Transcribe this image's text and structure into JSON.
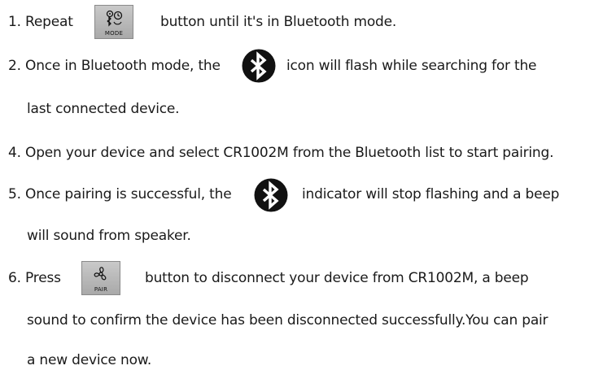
{
  "steps": [
    {
      "id": "1",
      "before": "1. Repeat",
      "after": "button until it's in Bluetooth mode.",
      "button_caption": "MODE"
    },
    {
      "id": "2",
      "before": "2. Once in Bluetooth mode, the",
      "after": "icon will flash while searching for the",
      "continuation": "last connected device."
    },
    {
      "id": "4",
      "text": "4. Open your device and select CR1002M from the Bluetooth list to start pairing."
    },
    {
      "id": "5",
      "before": "5. Once pairing is successful, the",
      "after": "indicator will stop flashing and a beep",
      "continuation": "will sound from speaker."
    },
    {
      "id": "6",
      "before": "6. Press",
      "after": "button to disconnect your device from CR1002M, a beep",
      "button_caption": "PAIR",
      "continuation": "sound to confirm the device has been disconnected successfully.You can pair",
      "continuation2": "a new device now."
    }
  ],
  "icons": {
    "mode_button": "mode-icon",
    "bluetooth": "bluetooth-icon",
    "pair_button": "fan-icon"
  },
  "colors": {
    "text": "#1a1a1a",
    "button_bg": "#b8b8b8",
    "bluetooth_bg": "#111111"
  }
}
